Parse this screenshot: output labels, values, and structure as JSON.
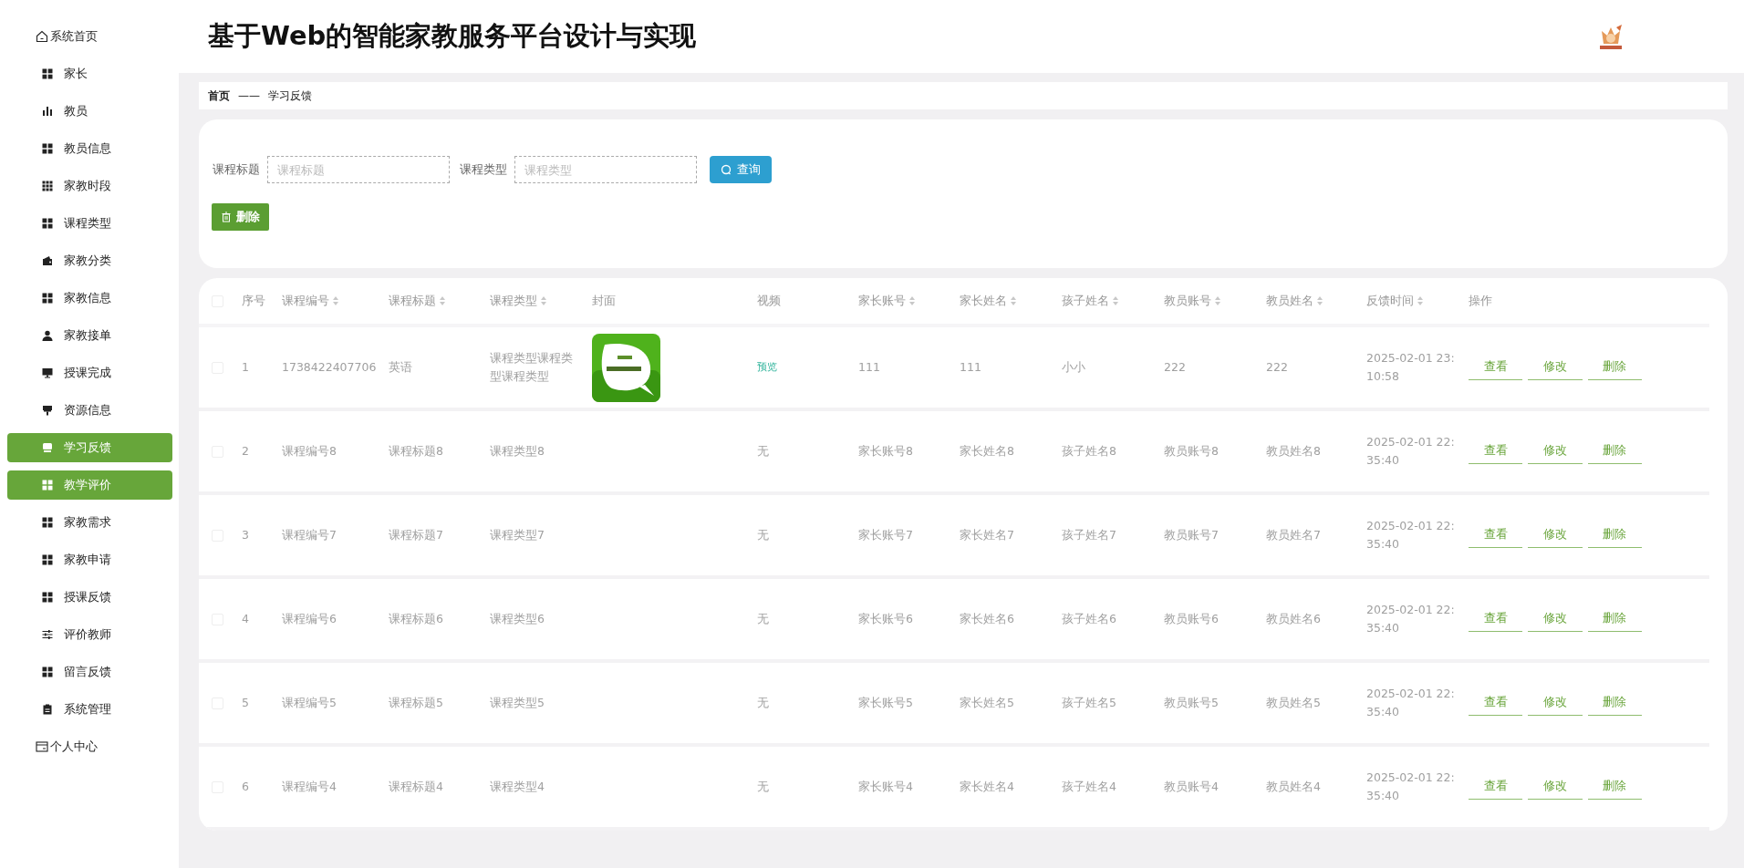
{
  "sidebar": {
    "items": [
      {
        "label": "系统首页",
        "kind": "top",
        "selected": false
      },
      {
        "label": "家长",
        "kind": "sub",
        "selected": false
      },
      {
        "label": "教员",
        "kind": "sub",
        "selected": false
      },
      {
        "label": "教员信息",
        "kind": "sub",
        "selected": false
      },
      {
        "label": "家教时段",
        "kind": "sub",
        "selected": false
      },
      {
        "label": "课程类型",
        "kind": "sub",
        "selected": false
      },
      {
        "label": "家教分类",
        "kind": "sub",
        "selected": false
      },
      {
        "label": "家教信息",
        "kind": "sub",
        "selected": false
      },
      {
        "label": "家教接单",
        "kind": "sub",
        "selected": false
      },
      {
        "label": "授课完成",
        "kind": "sub",
        "selected": false
      },
      {
        "label": "资源信息",
        "kind": "sub",
        "selected": false
      },
      {
        "label": "学习反馈",
        "kind": "sub",
        "selected": true
      },
      {
        "label": "教学评价",
        "kind": "sub",
        "selected": true
      },
      {
        "label": "家教需求",
        "kind": "sub",
        "selected": false
      },
      {
        "label": "家教申请",
        "kind": "sub",
        "selected": false
      },
      {
        "label": "授课反馈",
        "kind": "sub",
        "selected": false
      },
      {
        "label": "评价教师",
        "kind": "sub",
        "selected": false
      },
      {
        "label": "留言反馈",
        "kind": "sub",
        "selected": false
      },
      {
        "label": "系统管理",
        "kind": "sub",
        "selected": false
      },
      {
        "label": "个人中心",
        "kind": "top",
        "selected": false
      }
    ]
  },
  "header": {
    "title": "基于Web的智能家教服务平台设计与实现"
  },
  "breadcrumb": {
    "home": "首页",
    "separator": "——",
    "current": "学习反馈"
  },
  "search": {
    "fields": [
      {
        "label": "课程标题",
        "placeholder": "课程标题"
      },
      {
        "label": "课程类型",
        "placeholder": "课程类型"
      }
    ],
    "query_button": "查询",
    "delete_button": "删除"
  },
  "table": {
    "select_all_checked": false,
    "columns": [
      {
        "label": "序号",
        "sortable": false
      },
      {
        "label": "课程编号",
        "sortable": true
      },
      {
        "label": "课程标题",
        "sortable": true
      },
      {
        "label": "课程类型",
        "sortable": true
      },
      {
        "label": "封面",
        "sortable": false
      },
      {
        "label": "视频",
        "sortable": false
      },
      {
        "label": "家长账号",
        "sortable": true
      },
      {
        "label": "家长姓名",
        "sortable": true
      },
      {
        "label": "孩子姓名",
        "sortable": true
      },
      {
        "label": "教员账号",
        "sortable": true
      },
      {
        "label": "教员姓名",
        "sortable": true
      },
      {
        "label": "反馈时间",
        "sortable": true
      },
      {
        "label": "操作",
        "sortable": false
      }
    ],
    "rows": [
      {
        "checked": false,
        "index": "1",
        "code": "1738422407706",
        "title": "英语",
        "type": "课程类型课程类型课程类型",
        "video": {
          "text": "预览",
          "link": true
        },
        "parent_account": "111",
        "parent_name": "111",
        "child_name": "小小",
        "teacher_account": "222",
        "teacher_name": "222",
        "time": "2025-02-01 23:10:58",
        "actions": [
          "查看",
          "修改",
          "删除"
        ]
      },
      {
        "checked": false,
        "index": "2",
        "code": "课程编号8",
        "title": "课程标题8",
        "type": "课程类型8",
        "video": {
          "text": "无",
          "link": false
        },
        "parent_account": "家长账号8",
        "parent_name": "家长姓名8",
        "child_name": "孩子姓名8",
        "teacher_account": "教员账号8",
        "teacher_name": "教员姓名8",
        "time": "2025-02-01 22:35:40",
        "actions": [
          "查看",
          "修改",
          "删除"
        ]
      },
      {
        "checked": false,
        "index": "3",
        "code": "课程编号7",
        "title": "课程标题7",
        "type": "课程类型7",
        "video": {
          "text": "无",
          "link": false
        },
        "parent_account": "家长账号7",
        "parent_name": "家长姓名7",
        "child_name": "孩子姓名7",
        "teacher_account": "教员账号7",
        "teacher_name": "教员姓名7",
        "time": "2025-02-01 22:35:40",
        "actions": [
          "查看",
          "修改",
          "删除"
        ]
      },
      {
        "checked": false,
        "index": "4",
        "code": "课程编号6",
        "title": "课程标题6",
        "type": "课程类型6",
        "video": {
          "text": "无",
          "link": false
        },
        "parent_account": "家长账号6",
        "parent_name": "家长姓名6",
        "child_name": "孩子姓名6",
        "teacher_account": "教员账号6",
        "teacher_name": "教员姓名6",
        "time": "2025-02-01 22:35:40",
        "actions": [
          "查看",
          "修改",
          "删除"
        ]
      },
      {
        "checked": false,
        "index": "5",
        "code": "课程编号5",
        "title": "课程标题5",
        "type": "课程类型5",
        "video": {
          "text": "无",
          "link": false
        },
        "parent_account": "家长账号5",
        "parent_name": "家长姓名5",
        "child_name": "孩子姓名5",
        "teacher_account": "教员账号5",
        "teacher_name": "教员姓名5",
        "time": "2025-02-01 22:35:40",
        "actions": [
          "查看",
          "修改",
          "删除"
        ]
      },
      {
        "checked": false,
        "index": "6",
        "code": "课程编号4",
        "title": "课程标题4",
        "type": "课程类型4",
        "video": {
          "text": "无",
          "link": false
        },
        "parent_account": "家长账号4",
        "parent_name": "家长姓名4",
        "child_name": "孩子姓名4",
        "teacher_account": "教员账号4",
        "teacher_name": "教员姓名4",
        "time": "2025-02-01 22:35:40",
        "actions": [
          "查看",
          "修改",
          "删除"
        ]
      }
    ]
  }
}
